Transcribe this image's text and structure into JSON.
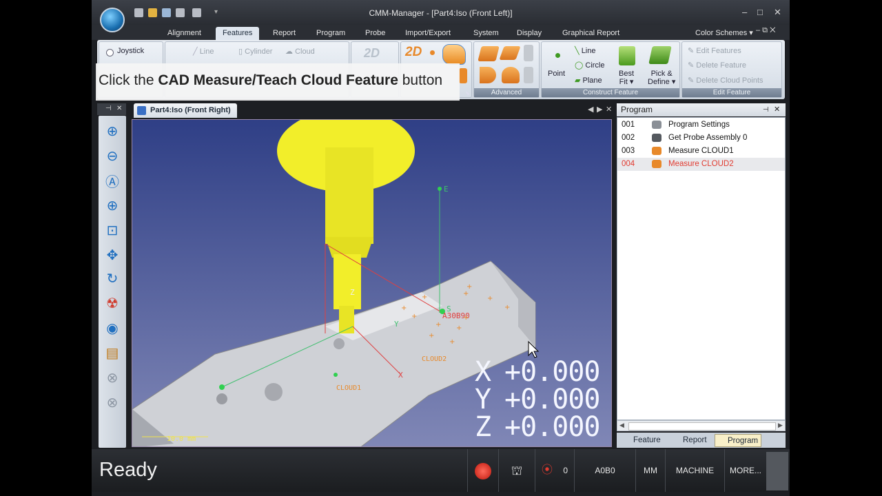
{
  "window": {
    "title": "CMM-Manager - [Part4:Iso (Front Left)]"
  },
  "menu_tabs": [
    "Alignment",
    "Features",
    "Report",
    "Program",
    "Probe",
    "Import/Export",
    "System",
    "Display",
    "Graphical Report"
  ],
  "color_schemes_label": "Color Schemes",
  "ribbon": {
    "joystick": "Joystick",
    "line_dim": "Line",
    "cylinder": "Cylinder",
    "cloud": "Cloud",
    "advanced_label": "Advanced",
    "point": "Point",
    "line": "Line",
    "circle": "Circle",
    "plane": "Plane",
    "best_fit_1": "Best",
    "best_fit_2": "Fit",
    "pick_define_1": "Pick &",
    "pick_define_2": "Define",
    "construct_label": "Construct Feature",
    "edit_features": "Edit Features",
    "delete_feature": "Delete Feature",
    "delete_cloud_points": "Delete Cloud Points",
    "edit_feature_label": "Edit Feature"
  },
  "tip": {
    "prefix": "Click the ",
    "bold": "CAD Measure/Teach Cloud Feature",
    "suffix": " button"
  },
  "viewport": {
    "tab_title": "Part4:Iso (Front Right)",
    "labels": {
      "e": "E",
      "z": "Z",
      "y": "Y",
      "x": "X",
      "s": "S",
      "orientation": "A30B90",
      "cloud": "CLOUD2",
      "cloud1": "CLOUD1",
      "scale": "10.0 mm"
    },
    "readout": {
      "x_axis": "X",
      "x_val": "+0.000",
      "y_axis": "Y",
      "y_val": "+0.000",
      "z_axis": "Z",
      "z_val": "+0.000"
    }
  },
  "program_panel": {
    "title": "Program",
    "rows": [
      {
        "num": "001",
        "label": "Program Settings",
        "icon": "wrench-icon"
      },
      {
        "num": "002",
        "label": "Get Probe Assembly 0",
        "icon": "probe-icon"
      },
      {
        "num": "003",
        "label": "Measure CLOUD1",
        "icon": "cloud-icon"
      },
      {
        "num": "004",
        "label": "Measure CLOUD2",
        "icon": "cloud-icon"
      }
    ],
    "tabs": [
      "Feature",
      "Report",
      "Program"
    ]
  },
  "status_bar": {
    "ready": "Ready",
    "probe_count": "0",
    "orientation": "A0B0",
    "units": "MM",
    "machine": "MACHINE",
    "more": "MORE..."
  },
  "colors": {
    "accent": "#e13a2f",
    "viewport_top": "#2f3f86",
    "viewport_bottom": "#8087b6",
    "part": "#d8d8d8",
    "probe": "#f2ee2a"
  }
}
